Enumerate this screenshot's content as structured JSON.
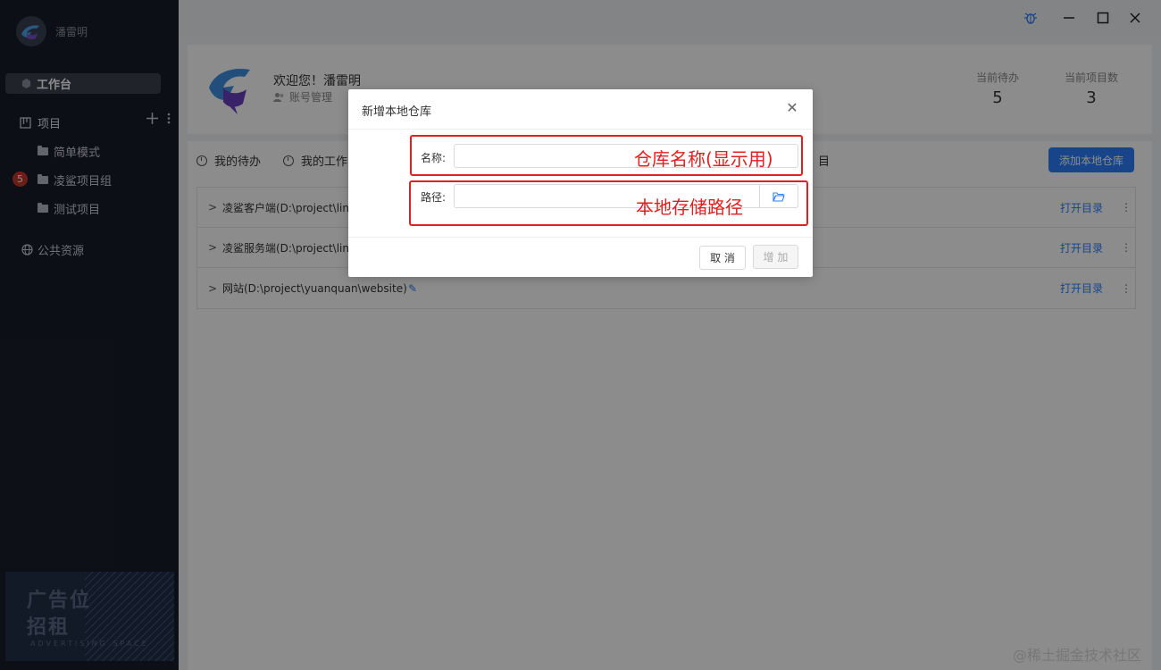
{
  "sidebar": {
    "username": "潘雷明",
    "workbench": "工作台",
    "projects_label": "项目",
    "items": [
      {
        "label": "简单模式"
      },
      {
        "label": "凌鲨项目组",
        "badge": "5"
      },
      {
        "label": "测试项目"
      }
    ],
    "public_resources": "公共资源",
    "ad": {
      "line1": "广告位",
      "line2": "招租",
      "line3": "ADVERTISING SPACE"
    }
  },
  "header": {
    "welcome": "欢迎您！潘雷明",
    "account_manage": "账号管理",
    "stats": [
      {
        "label": "当前待办",
        "value": "5"
      },
      {
        "label": "当前项目数",
        "value": "3"
      }
    ]
  },
  "tabs": [
    {
      "label": "我的待办"
    },
    {
      "label": "我的工作"
    }
  ],
  "tab_partial": "目",
  "add_repo_button": "添加本地仓库",
  "repos": [
    {
      "name": "凌鲨客户端(D:\\project\\links",
      "open": "打开目录"
    },
    {
      "name": "凌鲨服务端(D:\\project\\links",
      "open": "打开目录"
    },
    {
      "name": "网站(D:\\project\\yuanquan\\website)",
      "open": "打开目录"
    }
  ],
  "modal": {
    "title": "新增本地仓库",
    "name_label": "名称:",
    "name_value": "",
    "path_label": "路径:",
    "path_value": "",
    "cancel": "取 消",
    "add": "增 加"
  },
  "annotations": {
    "name": "仓库名称(显示用)",
    "path": "本地存储路径"
  },
  "watermark": "@稀土掘金技术社区",
  "colors": {
    "accent": "#2d7ff9",
    "annotation": "#e02020",
    "sidebar_bg": "#191d2b"
  }
}
